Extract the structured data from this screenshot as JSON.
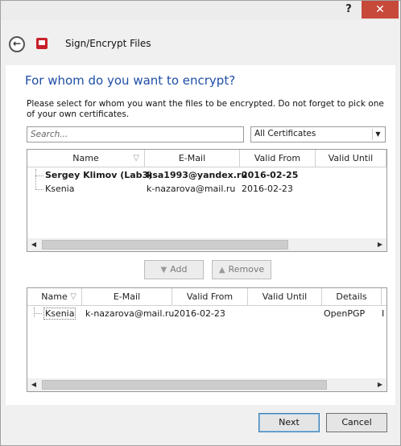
{
  "titlebar": {
    "help": "?",
    "close": "✕"
  },
  "header": {
    "back_icon": "back-arrow-icon",
    "title": "Sign/Encrypt Files"
  },
  "main": {
    "heading": "For whom do you want to encrypt?",
    "description": "Please select for whom you want the files to be encrypted. Do not forget to pick one of your own certificates.",
    "search_placeholder": "Search...",
    "filter_selected": "All Certificates"
  },
  "available": {
    "columns": [
      "Name",
      "E-Mail",
      "Valid From",
      "Valid Until"
    ],
    "rows": [
      {
        "name": "Sergey Klimov (Lab3)",
        "email": "ksa1993@yandex.ru",
        "valid_from": "2016-02-25",
        "valid_until": "",
        "bold": true
      },
      {
        "name": "Ksenia",
        "email": "k-nazarova@mail.ru",
        "valid_from": "2016-02-23",
        "valid_until": "",
        "bold": false
      }
    ]
  },
  "actions": {
    "add": "Add",
    "remove": "Remove"
  },
  "selected": {
    "columns": [
      "Name",
      "E-Mail",
      "Valid From",
      "Valid Until",
      "Details"
    ],
    "rows": [
      {
        "name": "Ksenia",
        "email": "k-nazarova@mail.ru",
        "valid_from": "2016-02-23",
        "valid_until": "",
        "details": "OpenPGP",
        "extra": "I"
      }
    ]
  },
  "footer": {
    "next": "Next",
    "cancel": "Cancel"
  }
}
